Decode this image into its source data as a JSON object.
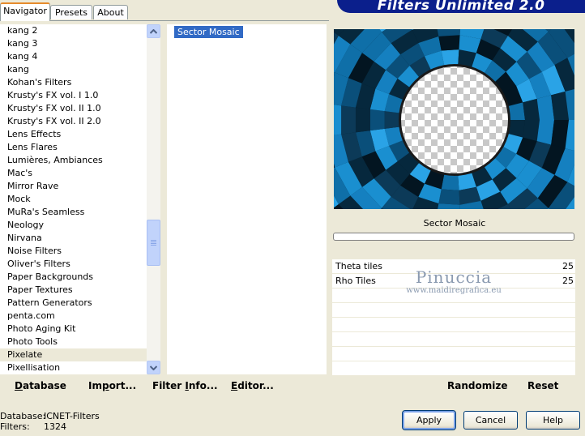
{
  "tabs": [
    {
      "label": "Navigator"
    },
    {
      "label": "Presets"
    },
    {
      "label": "About"
    }
  ],
  "banner": {
    "title": "Filters Unlimited 2.0"
  },
  "categories": [
    "kang 2",
    "kang 3",
    "kang 4",
    "kang",
    "Kohan's Filters",
    "Krusty's FX vol. I 1.0",
    "Krusty's FX vol. II 1.0",
    "Krusty's FX vol. II 2.0",
    "Lens Effects",
    "Lens Flares",
    "Lumières, Ambiances",
    "Mac's",
    "Mirror Rave",
    "Mock",
    "MuRa's Seamless",
    "Neology",
    "Nirvana",
    "Noise Filters",
    "Oliver's Filters",
    "Paper Backgrounds",
    "Paper Textures",
    "Pattern Generators",
    "penta.com",
    "Photo Aging Kit",
    "Photo Tools",
    "Pixelate",
    "Pixellisation"
  ],
  "selected_category": "Pixelate",
  "scrollbar": {
    "position": 0.56
  },
  "filters": {
    "selected": "Sector Mosaic"
  },
  "preview": {
    "filter_name": "Sector Mosaic"
  },
  "params": [
    {
      "name": "Theta tiles",
      "value": "25"
    },
    {
      "name": "Rho Tiles",
      "value": "25"
    }
  ],
  "watermark": {
    "name": "Pinuccia",
    "url": "www.maidiregrafica.eu"
  },
  "bottom": {
    "database": {
      "u": "D",
      "rest": "atabase"
    },
    "import": {
      "pre": "Im",
      "u": "p",
      "rest": "ort..."
    },
    "filter_info": {
      "pre": "Filter ",
      "u": "I",
      "rest": "nfo..."
    },
    "editor": {
      "u": "E",
      "rest": "ditor..."
    },
    "randomize": "Randomize",
    "reset": "Reset"
  },
  "status": {
    "database_label": "Database:",
    "database_value": "ICNET-Filters",
    "filters_label": "Filters:",
    "filters_value": "1324"
  },
  "buttons": {
    "apply": "Apply",
    "cancel": "Cancel",
    "help": "Help"
  }
}
